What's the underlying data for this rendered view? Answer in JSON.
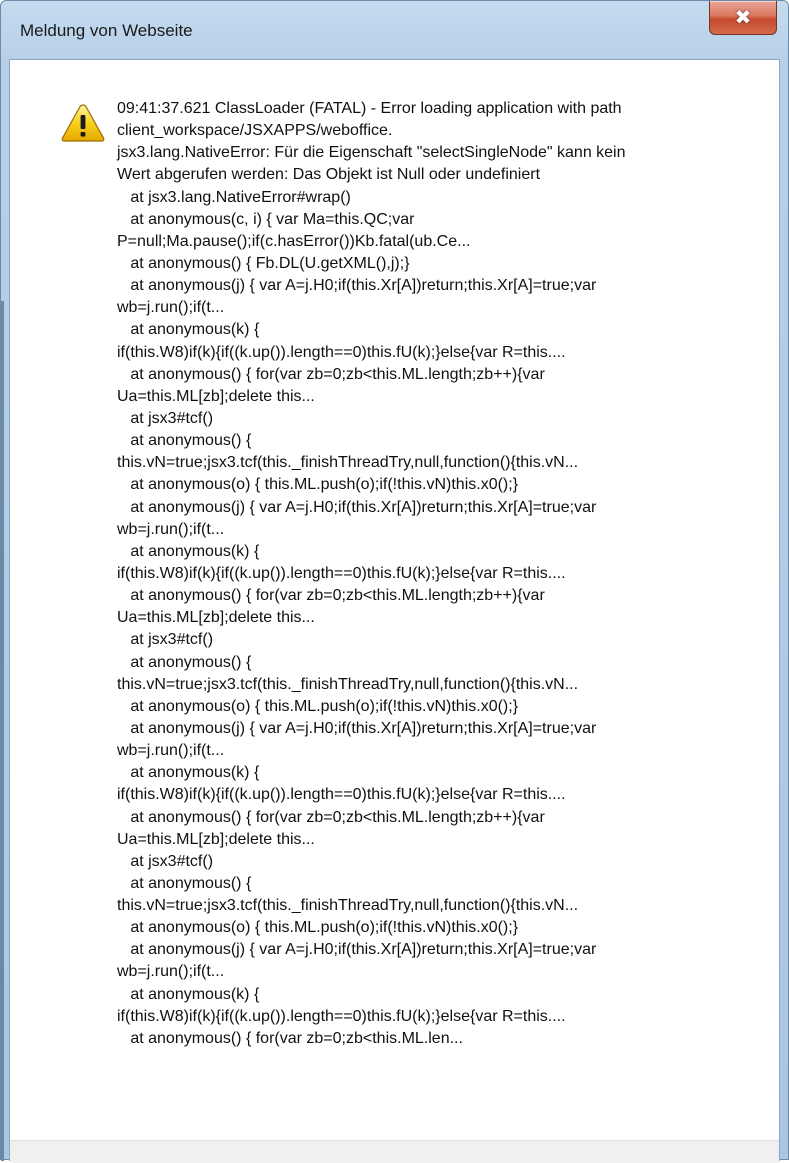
{
  "window": {
    "title": "Meldung von Webseite",
    "close_glyph": "✖"
  },
  "icon": "warning-icon",
  "message_lines": [
    "09:41:37.621 ClassLoader (FATAL) - Error loading application with path",
    "client_workspace/JSXAPPS/weboffice.",
    "jsx3.lang.NativeError: Für die Eigenschaft \"selectSingleNode\" kann kein",
    "Wert abgerufen werden: Das Objekt ist Null oder undefiniert",
    "   at jsx3.lang.NativeError#wrap()",
    "   at anonymous(c, i) { var Ma=this.QC;var",
    "P=null;Ma.pause();if(c.hasError())Kb.fatal(ub.Ce...",
    "   at anonymous() { Fb.DL(U.getXML(),j);}",
    "   at anonymous(j) { var A=j.H0;if(this.Xr[A])return;this.Xr[A]=true;var",
    "wb=j.run();if(t...",
    "   at anonymous(k) {",
    "if(this.W8)if(k){if((k.up()).length==0)this.fU(k);}else{var R=this....",
    "   at anonymous() { for(var zb=0;zb<this.ML.length;zb++){var",
    "Ua=this.ML[zb];delete this...",
    "   at jsx3#tcf()",
    "   at anonymous() {",
    "this.vN=true;jsx3.tcf(this._finishThreadTry,null,function(){this.vN...",
    "   at anonymous(o) { this.ML.push(o);if(!this.vN)this.x0();}",
    "   at anonymous(j) { var A=j.H0;if(this.Xr[A])return;this.Xr[A]=true;var",
    "wb=j.run();if(t...",
    "   at anonymous(k) {",
    "if(this.W8)if(k){if((k.up()).length==0)this.fU(k);}else{var R=this....",
    "   at anonymous() { for(var zb=0;zb<this.ML.length;zb++){var",
    "Ua=this.ML[zb];delete this...",
    "   at jsx3#tcf()",
    "   at anonymous() {",
    "this.vN=true;jsx3.tcf(this._finishThreadTry,null,function(){this.vN...",
    "   at anonymous(o) { this.ML.push(o);if(!this.vN)this.x0();}",
    "   at anonymous(j) { var A=j.H0;if(this.Xr[A])return;this.Xr[A]=true;var",
    "wb=j.run();if(t...",
    "   at anonymous(k) {",
    "if(this.W8)if(k){if((k.up()).length==0)this.fU(k);}else{var R=this....",
    "   at anonymous() { for(var zb=0;zb<this.ML.length;zb++){var",
    "Ua=this.ML[zb];delete this...",
    "   at jsx3#tcf()",
    "   at anonymous() {",
    "this.vN=true;jsx3.tcf(this._finishThreadTry,null,function(){this.vN...",
    "   at anonymous(o) { this.ML.push(o);if(!this.vN)this.x0();}",
    "   at anonymous(j) { var A=j.H0;if(this.Xr[A])return;this.Xr[A]=true;var",
    "wb=j.run();if(t...",
    "   at anonymous(k) {",
    "if(this.W8)if(k){if((k.up()).length==0)this.fU(k);}else{var R=this....",
    "   at anonymous() { for(var zb=0;zb<this.ML.len..."
  ],
  "colors": {
    "frame": "#b7d0e8",
    "close_button": "#c34a2f",
    "warning_fill": "#f5c400"
  }
}
